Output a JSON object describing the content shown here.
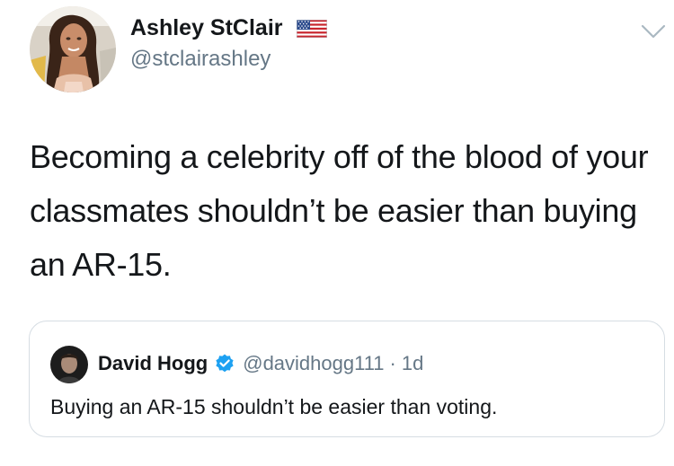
{
  "author": {
    "display_name": "Ashley StClair",
    "handle": "@stclairashley",
    "flag_icon": "us-flag-icon"
  },
  "menu_icon": "chevron-down-icon",
  "tweet": {
    "text": "Becoming a celebrity off of the blood of your classmates shouldn’t be easier than buying an AR-15."
  },
  "quoted_tweet": {
    "display_name": "David Hogg",
    "verified_icon": "verified-badge-icon",
    "handle": "@davidhogg111",
    "separator": "·",
    "time": "1d",
    "text": "Buying an AR-15 shouldn’t be easier than voting."
  },
  "colors": {
    "primary_text": "#14171a",
    "secondary_text": "#657786",
    "verified_blue": "#1da1f2",
    "border": "#d6dde3"
  }
}
